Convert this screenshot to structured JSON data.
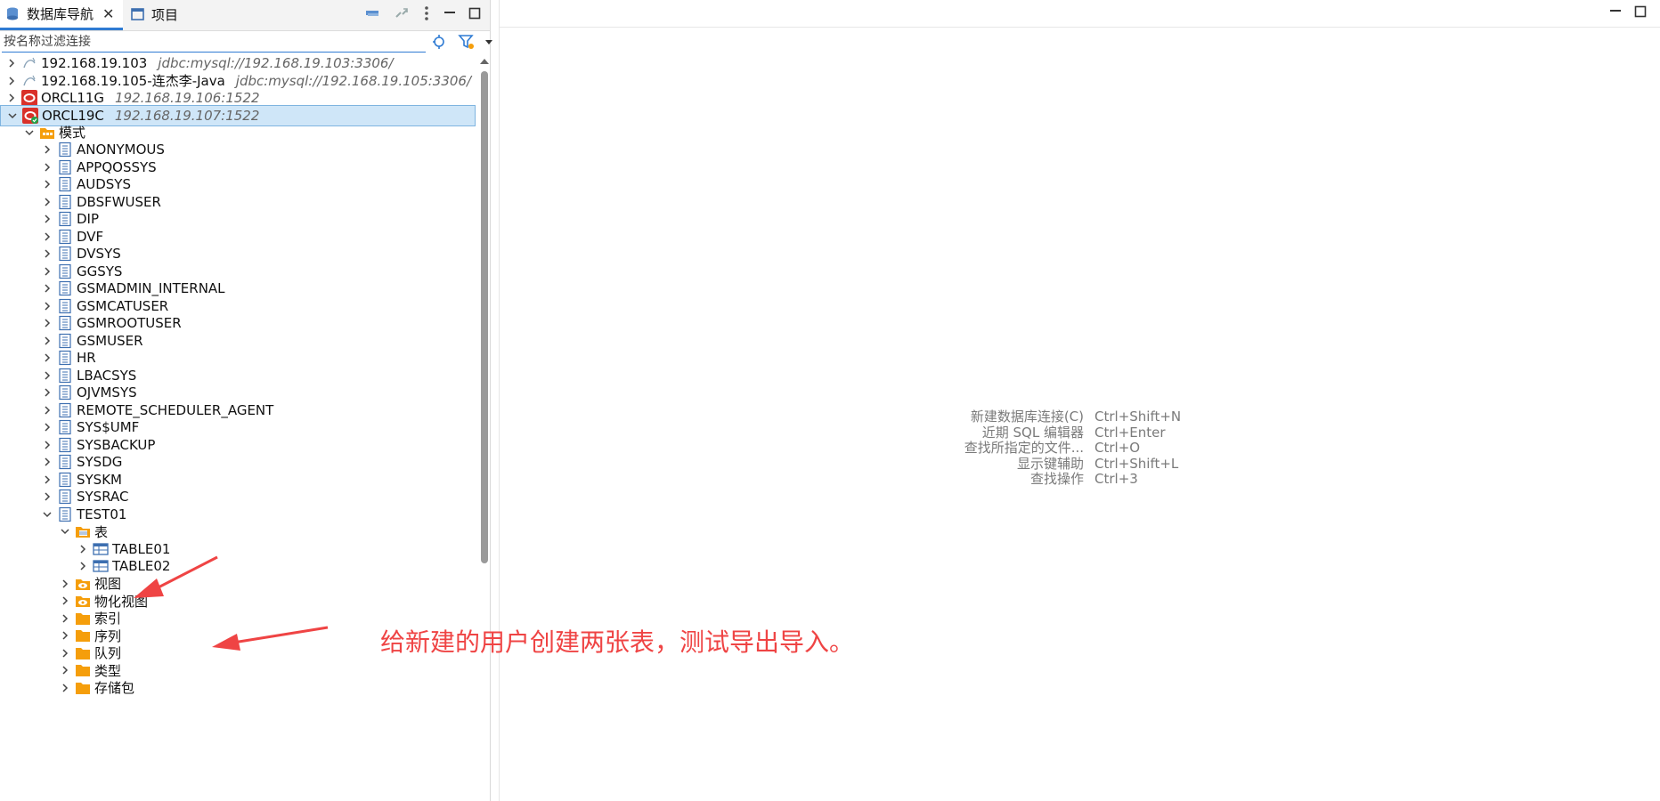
{
  "left_panel": {
    "tabs": [
      {
        "label": "数据库导航",
        "close": "✕"
      },
      {
        "label": "项目"
      }
    ],
    "filter_placeholder": "按名称过滤连接"
  },
  "tree": {
    "connections": [
      {
        "label": "192.168.19.103",
        "sub": "jdbc:mysql://192.168.19.103:3306/"
      },
      {
        "label": "192.168.19.105-连杰李-Java",
        "sub": "jdbc:mysql://192.168.19.105:3306/"
      },
      {
        "label": "ORCL11G",
        "sub": "192.168.19.106:1522"
      },
      {
        "label": "ORCL19C",
        "sub": "192.168.19.107:1522"
      }
    ],
    "schema_folder": "模式",
    "schemas": [
      "ANONYMOUS",
      "APPQOSSYS",
      "AUDSYS",
      "DBSFWUSER",
      "DIP",
      "DVF",
      "DVSYS",
      "GGSYS",
      "GSMADMIN_INTERNAL",
      "GSMCATUSER",
      "GSMROOTUSER",
      "GSMUSER",
      "HR",
      "LBACSYS",
      "OJVMSYS",
      "REMOTE_SCHEDULER_AGENT",
      "SYS$UMF",
      "SYSBACKUP",
      "SYSDG",
      "SYSKM",
      "SYSRAC",
      "TEST01"
    ],
    "tables_folder": "表",
    "tables": [
      "TABLE01",
      "TABLE02"
    ],
    "folders": [
      "视图",
      "物化视图",
      "索引",
      "序列",
      "队列",
      "类型",
      "存储包"
    ]
  },
  "shortcuts": [
    {
      "label": "新建数据库连接(C)",
      "key": "Ctrl+Shift+N"
    },
    {
      "label": "近期 SQL 编辑器",
      "key": "Ctrl+Enter"
    },
    {
      "label": "查找所指定的文件...",
      "key": "Ctrl+O"
    },
    {
      "label": "显示键辅助",
      "key": "Ctrl+Shift+L"
    },
    {
      "label": "查找操作",
      "key": "Ctrl+3"
    }
  ],
  "annotation": "给新建的用户创建两张表，测试导出导入。",
  "colors": {
    "accent": "#2f7bd3",
    "selection": "#cfe6f8",
    "annotation": "#ef4444",
    "oracle": "#d9312a",
    "folder": "#f59e0b"
  }
}
